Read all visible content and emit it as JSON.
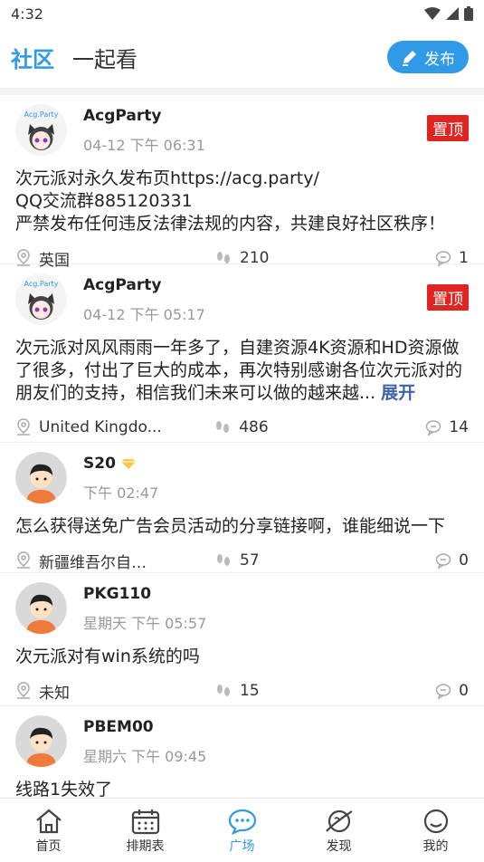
{
  "status": {
    "time": "4:32"
  },
  "header": {
    "tabs": [
      {
        "label": "社区"
      },
      {
        "label": "一起看"
      }
    ],
    "publish_label": "发布"
  },
  "posts": [
    {
      "user": "AcgParty",
      "time": "04-12 下午 06:31",
      "pin_label": "置顶",
      "content": "次元派对永久发布页https://acg.party/\nQQ交流群885120331\n严禁发布任何违反法律法规的内容，共建良好社区秩序！",
      "location": "英国",
      "views": "210",
      "comments": "1",
      "avatar": "acg-logo"
    },
    {
      "user": "AcgParty",
      "time": "04-12 下午 05:17",
      "pin_label": "置顶",
      "content": "次元派对风风雨雨一年多了，自建资源4K资源和HD资源做了很多，付出了巨大的成本，再次特别感谢各位次元派对的朋友们的支持，相信我们未来可以做的越来越...",
      "more_label": "展开",
      "location": "United Kingdo...",
      "views": "486",
      "comments": "14",
      "avatar": "acg-logo"
    },
    {
      "user": "S20",
      "time": "下午 02:47",
      "content": "怎么获得送免广告会员活动的分享链接啊，谁能细说一下",
      "location": "新疆维吾尔自…",
      "views": "57",
      "comments": "0",
      "avatar": "default-boy",
      "badge": "vip-diamond-icon"
    },
    {
      "user": "PKG110",
      "time": "星期天 下午 05:57",
      "content": "次元派对有win系统的吗",
      "location": "未知",
      "views": "15",
      "comments": "0",
      "avatar": "default-boy"
    },
    {
      "user": "PBEM00",
      "time": "星期六 下午 09:45",
      "content": "线路1失效了",
      "avatar": "default-boy"
    }
  ],
  "nav": [
    {
      "label": "首页",
      "icon": "home-icon"
    },
    {
      "label": "排期表",
      "icon": "calendar-icon"
    },
    {
      "label": "广场",
      "icon": "chat-bubble-icon"
    },
    {
      "label": "发现",
      "icon": "planet-icon"
    },
    {
      "label": "我的",
      "icon": "smile-icon"
    }
  ],
  "colors": {
    "accent": "#2f9be8",
    "pin": "#e0241f",
    "more": "#3f63a8"
  }
}
